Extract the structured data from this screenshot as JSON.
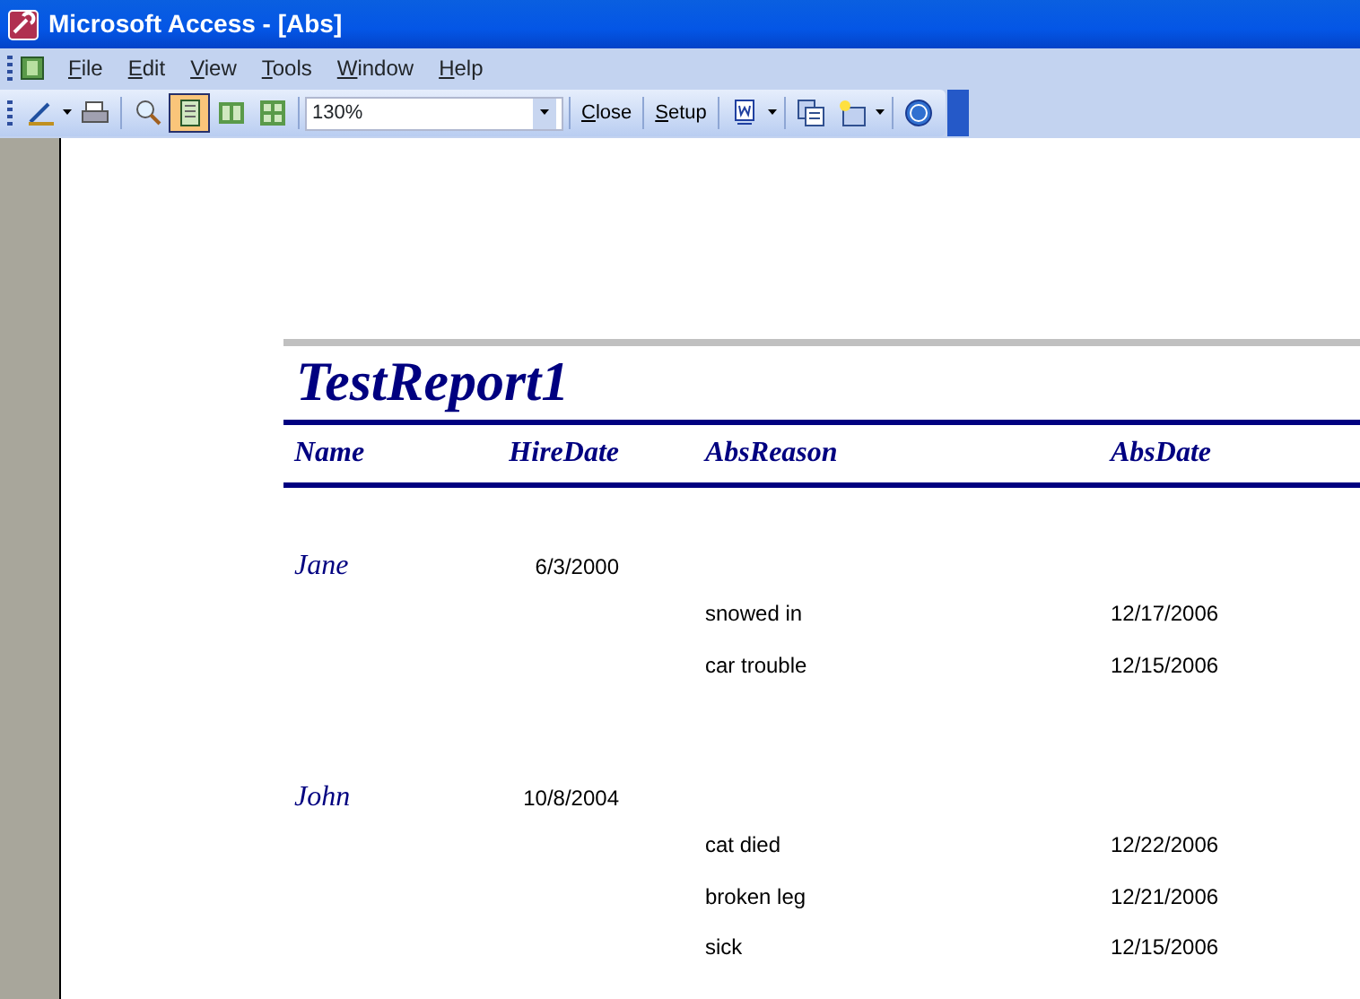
{
  "window": {
    "title": "Microsoft Access - [Abs]"
  },
  "menu": [
    "File",
    "Edit",
    "View",
    "Tools",
    "Window",
    "Help"
  ],
  "toolbar": {
    "view_buttons": [
      {
        "selected": false
      },
      {
        "selected": true
      },
      {
        "selected": false
      },
      {
        "selected": false
      }
    ],
    "zoom": "130%",
    "close": "Close",
    "setup": "Setup"
  },
  "report": {
    "title": "TestReport1",
    "columns": [
      "Name",
      "HireDate",
      "AbsReason",
      "AbsDate"
    ],
    "groups": [
      {
        "name": "Jane",
        "hire_date": "6/3/2000",
        "rows": [
          {
            "reason": "snowed in",
            "date": "12/17/2006"
          },
          {
            "reason": "car trouble",
            "date": "12/15/2006"
          }
        ]
      },
      {
        "name": "John",
        "hire_date": "10/8/2004",
        "rows": [
          {
            "reason": "cat died",
            "date": "12/22/2006"
          },
          {
            "reason": "broken leg",
            "date": "12/21/2006"
          },
          {
            "reason": "sick",
            "date": "12/15/2006"
          }
        ]
      }
    ]
  }
}
